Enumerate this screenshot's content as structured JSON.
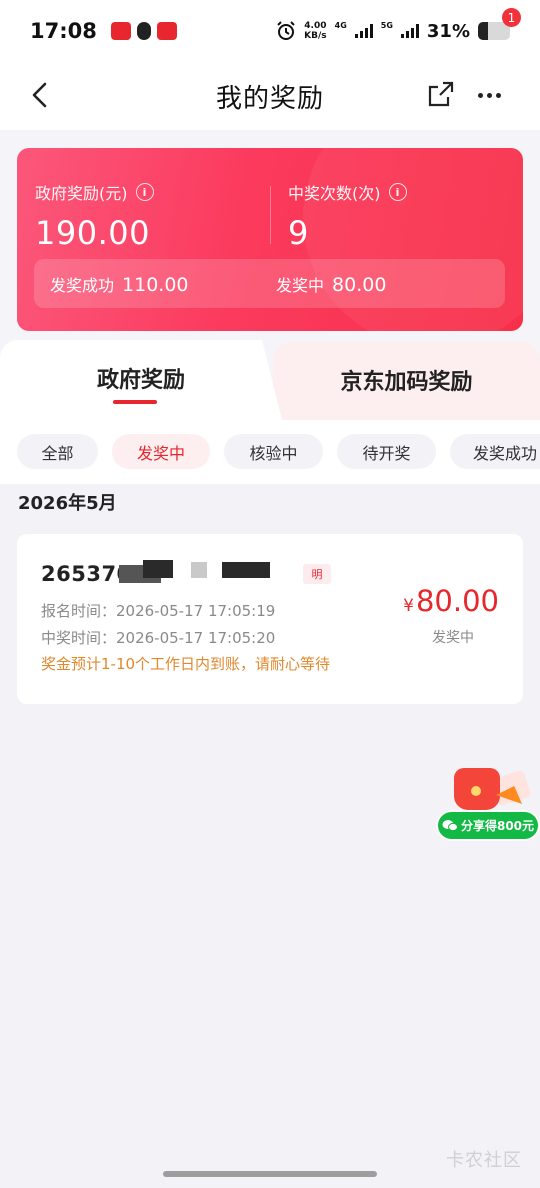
{
  "status_bar": {
    "time": "17:08",
    "speed_value": "4.00",
    "speed_unit": "KB/s",
    "net1": "4G",
    "net2": "5G",
    "battery": "31%"
  },
  "header": {
    "title": "我的奖励",
    "more_badge": "1"
  },
  "summary": {
    "gov_label": "政府奖励(元)",
    "gov_value": "190.00",
    "win_label": "中奖次数(次)",
    "win_value": "9",
    "success_label": "发奖成功",
    "success_value": "110.00",
    "pending_label": "发奖中",
    "pending_value": "80.00"
  },
  "tabs": [
    {
      "label": "政府奖励"
    },
    {
      "label": "京东加码奖励"
    }
  ],
  "filters": [
    {
      "label": "全部"
    },
    {
      "label": "发奖中"
    },
    {
      "label": "核验中"
    },
    {
      "label": "待开奖"
    },
    {
      "label": "发奖成功"
    }
  ],
  "month": "2026年5月",
  "record": {
    "id_visible": "265370",
    "rule_tag": "明",
    "signup_time": "报名时间：2026-05-17 17:05:19",
    "win_time": "中奖时间：2026-05-17 17:05:20",
    "note": "奖金预计1-10个工作日内到账，请耐心等待",
    "currency": "¥",
    "amount": "80.00",
    "status": "发奖中"
  },
  "float_share": {
    "label": "分享得800元"
  },
  "watermark": "卡农社区",
  "colors": {
    "accent_red": "#e8262d",
    "card_gradient_start": "#fb577a",
    "card_gradient_end": "#f8304a",
    "note_orange": "#e0892d",
    "share_green": "#12b944"
  }
}
